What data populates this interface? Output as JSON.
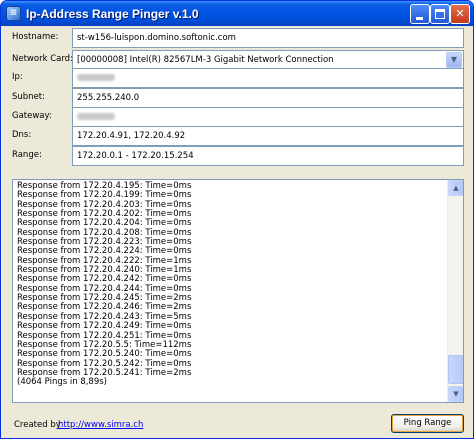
{
  "window": {
    "title": "Ip-Address Range Pinger v.1.0",
    "accent_color": "#0053e1",
    "icon": "app-icon"
  },
  "form": {
    "hostname_label": "Hostname:",
    "hostname_value": "st-w156-luispon.domino.softonic.com",
    "network_card_label": "Network Card:",
    "network_card_value": "[00000008] Intel(R) 82567LM-3 Gigabit Network Connection",
    "ip_label": "Ip:",
    "subnet_label": "Subnet:",
    "subnet_value": "255.255.240.0",
    "gateway_label": "Gateway:",
    "dns_label": "Dns:",
    "dns_value": "172.20.4.91, 172.20.4.92",
    "range_label": "Range:",
    "range_value": "172.20.0.1 - 172.20.15.254"
  },
  "log": {
    "lines": [
      "Response from 172.20.4.195: Time=0ms",
      "Response from 172.20.4.199: Time=0ms",
      "Response from 172.20.4.203: Time=0ms",
      "Response from 172.20.4.202: Time=0ms",
      "Response from 172.20.4.204: Time=0ms",
      "Response from 172.20.4.208: Time=0ms",
      "Response from 172.20.4.223: Time=0ms",
      "Response from 172.20.4.224: Time=0ms",
      "Response from 172.20.4.222: Time=1ms",
      "Response from 172.20.4.240: Time=1ms",
      "Response from 172.20.4.242: Time=0ms",
      "Response from 172.20.4.244: Time=0ms",
      "Response from 172.20.4.245: Time=2ms",
      "Response from 172.20.4.246: Time=2ms",
      "Response from 172.20.4.243: Time=5ms",
      "Response from 172.20.4.249: Time=0ms",
      "Response from 172.20.4.251: Time=0ms",
      "Response from 172.20.5.5: Time=112ms",
      "Response from 172.20.5.240: Time=0ms",
      "Response from 172.20.5.242: Time=0ms",
      "Response from 172.20.5.241: Time=2ms",
      "(4064 Pings in 8,89s)"
    ]
  },
  "footer": {
    "created_by_label": "Created by",
    "link_text": "http://www.simra.ch",
    "ping_button_label": "Ping Range"
  }
}
